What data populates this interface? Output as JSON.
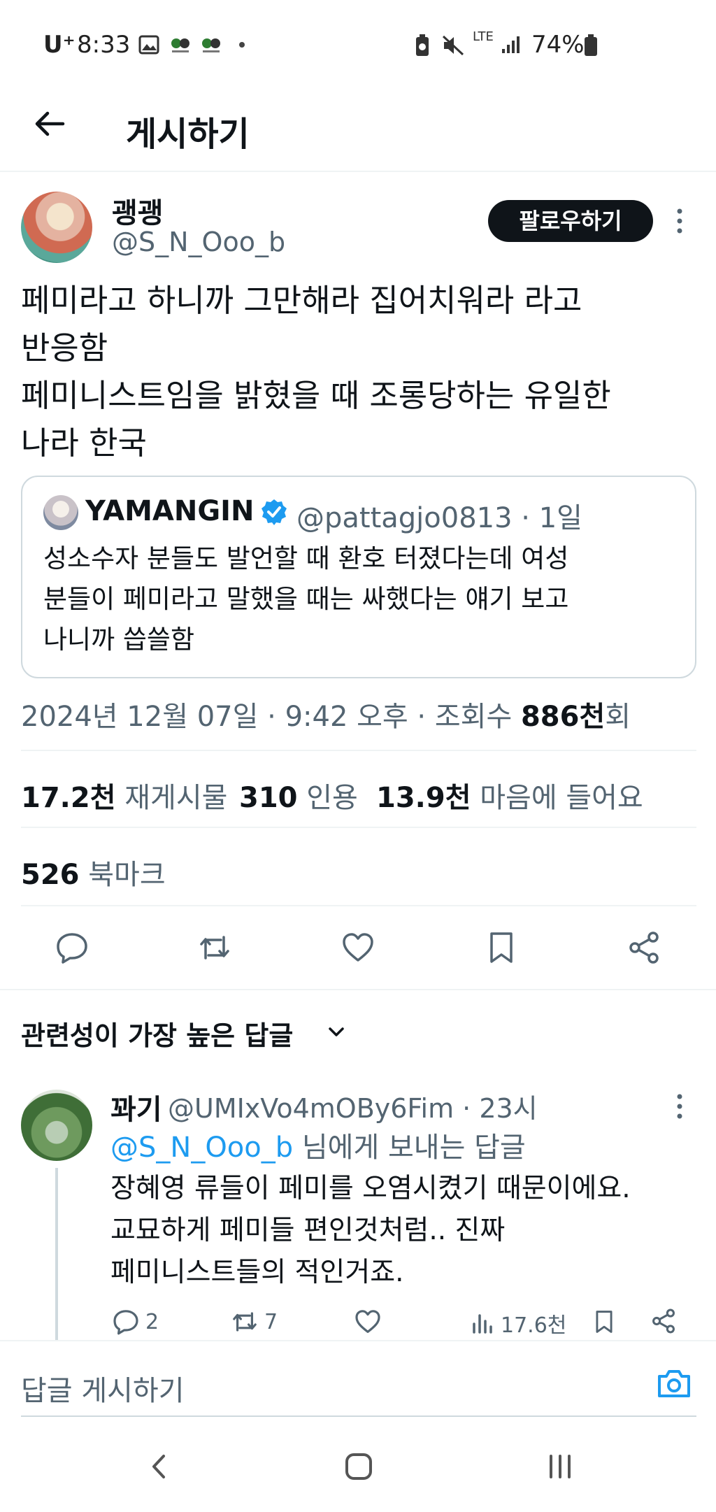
{
  "status_bar": {
    "carrier": "U⁺",
    "time": "8:33",
    "network": "LTE",
    "battery": "74%"
  },
  "header": {
    "title": "게시하기"
  },
  "tweet": {
    "author_name": "괭괭",
    "author_handle": "@S_N_Ooo_b",
    "follow_label": "팔로우하기",
    "text": "페미라고 하니까 그만해라 집어치워라 라고\n반응함\n페미니스트임을 밝혔을 때 조롱당하는 유일한\n나라 한국",
    "quote": {
      "author_name": "YAMANGIN",
      "author_handle": "@pattagjo0813 · 1일",
      "text": "성소수자 분들도 발언할 때 환호 터졌다는데 여성\n분들이 페미라고 말했을 때는 싸했다는 얘기 보고\n나니까 씁쓸함"
    },
    "meta_prefix": "2024년 12월 07일 · 9:42 오후 · 조회수 ",
    "views": "886천",
    "views_suffix": "회",
    "stats": {
      "reposts_count": "17.2천",
      "reposts_label": "재게시물",
      "quotes_count": "310",
      "quotes_label": "인용",
      "likes_count": "13.9천",
      "likes_label": "마음에 들어요",
      "bookmarks_count": "526",
      "bookmarks_label": "북마크"
    }
  },
  "replies": {
    "sort_label": "관련성이 가장 높은 답글",
    "items": [
      {
        "author_name": "꽈기",
        "author_handle": "@UMIxVo4mOBy6Fim · 23시",
        "reply_to_handle": "@S_N_Ooo_b",
        "reply_to_suffix": " 님에게 보내는 답글",
        "text": "장혜영 류들이 페미를 오염시켰기 때문이에요.\n교묘하게 페미들 편인것처럼.. 진짜\n페미니스트들의 적인거죠.",
        "replies_count": "2",
        "reposts_count": "7",
        "views_count": "17.6천"
      }
    ]
  },
  "compose": {
    "placeholder": "답글 게시하기"
  },
  "colors": {
    "accent": "#1d9bf0",
    "text": "#0f1419",
    "muted": "#536471",
    "border": "#cfd9de"
  }
}
